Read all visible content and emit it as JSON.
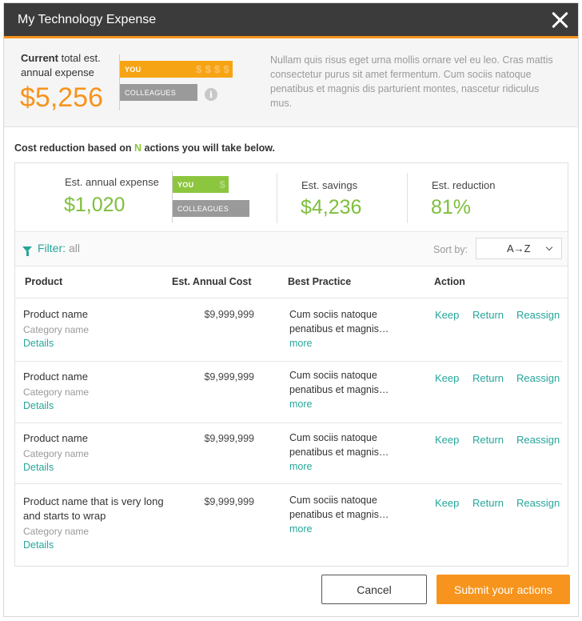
{
  "modal": {
    "title": "My Technology Expense"
  },
  "summary": {
    "label_bold": "Current",
    "label_rest": "total est. annual expense",
    "value": "$5,256",
    "bar_you": "YOU",
    "bar_colleagues": "COLLEAGUES",
    "ghost_dollars": "$ $ $ $",
    "info_glyph": "i",
    "description": "Nullam quis risus eget urna mollis ornare vel eu leo. Cras mattis consectetur purus sit amet fermentum. Cum sociis natoque penatibus et magnis dis parturient montes, nascetur ridiculus mus."
  },
  "subhead": {
    "prefix": "Cost reduction based on ",
    "n": "N",
    "suffix": " actions you will take below."
  },
  "stats": {
    "expense_label": "Est. annual expense",
    "expense_value": "$1,020",
    "bar_you": "YOU",
    "bar_colleagues": "COLLEAGUES",
    "ghost_dollar": "$",
    "savings_label": "Est. savings",
    "savings_value": "$4,236",
    "reduction_label": "Est. reduction",
    "reduction_value": "81%"
  },
  "filter": {
    "label": "Filter:",
    "value": "all",
    "sort_label": "Sort by:",
    "sort_value": "A→Z"
  },
  "table": {
    "headers": {
      "product": "Product",
      "cost": "Est. Annual Cost",
      "practice": "Best Practice",
      "action": "Action"
    },
    "rows": [
      {
        "name": "Product name",
        "category": "Category name",
        "details": "Details",
        "cost": "$9,999,999",
        "practice_1": "Cum sociis natoque",
        "practice_2": "penatibus et magnis…",
        "more": "more",
        "keep": "Keep",
        "return": "Return",
        "reassign": "Reassign"
      },
      {
        "name": "Product name",
        "category": "Category name",
        "details": "Details",
        "cost": "$9,999,999",
        "practice_1": "Cum sociis natoque",
        "practice_2": "penatibus et magnis…",
        "more": "more",
        "keep": "Keep",
        "return": "Return",
        "reassign": "Reassign"
      },
      {
        "name": "Product name",
        "category": "Category name",
        "details": "Details",
        "cost": "$9,999,999",
        "practice_1": "Cum sociis natoque",
        "practice_2": "penatibus et magnis…",
        "more": "more",
        "keep": "Keep",
        "return": "Return",
        "reassign": "Reassign"
      },
      {
        "name": "Product name that is very long and starts to wrap",
        "category": "Category name",
        "details": "Details",
        "cost": "$9,999,999",
        "practice_1": "Cum sociis natoque",
        "practice_2": "penatibus et magnis…",
        "more": "more",
        "keep": "Keep",
        "return": "Return",
        "reassign": "Reassign"
      }
    ]
  },
  "buttons": {
    "cancel": "Cancel",
    "submit": "Submit your actions"
  },
  "colors": {
    "accent": "#f7941d",
    "green": "#8cc63f",
    "teal": "#26a69a",
    "titlebar": "#3b3b3b"
  }
}
